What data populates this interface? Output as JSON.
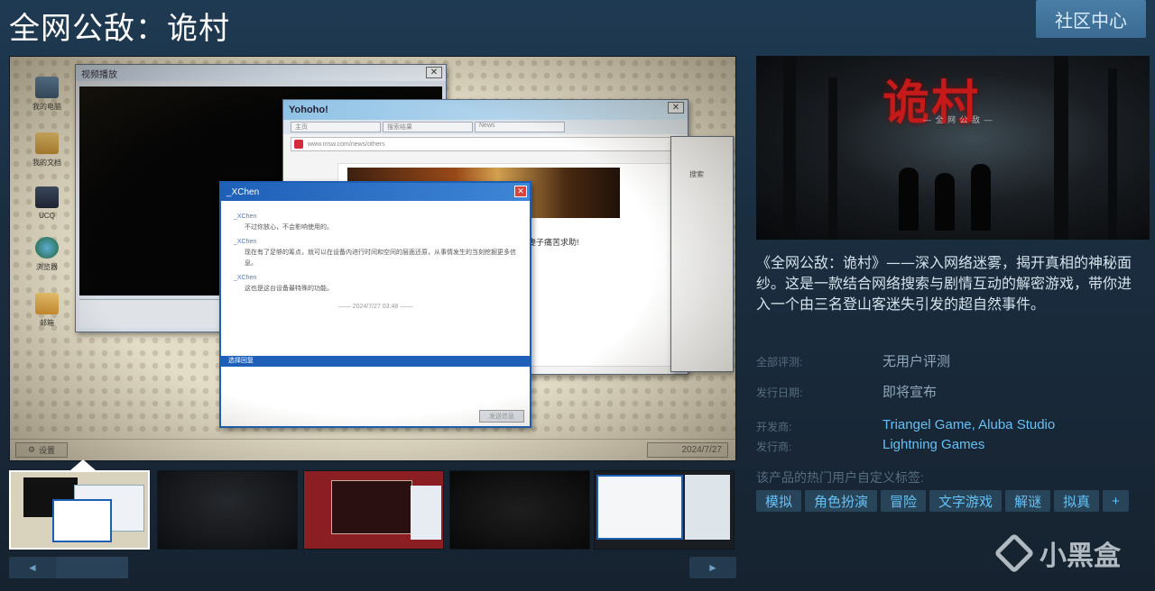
{
  "header": {
    "title": "全网公敌：诡村",
    "community_button": "社区中心"
  },
  "screenshot": {
    "desktop_icons": [
      "我的电脑",
      "我的文档",
      "UCQ",
      "浏览器",
      "邮箱"
    ],
    "video_window_title": "视频播放",
    "browser_window_title": "Yohoho!",
    "browser_tabs": [
      "主页",
      "搜索结果",
      "News"
    ],
    "browser_url": "www.msw.com/news/others",
    "article_snippet": "妻子痛苦求助!",
    "side_window_text": "搜索",
    "chat_window_title": "_XChen",
    "chat_messages": [
      {
        "name": "_XChen",
        "text": "不过你放心，不会影响使用的。"
      },
      {
        "name": "_XChen",
        "text": "现在有了足够的筹点，就可以在设备内进行时间和空间的层面还原，从事情发生的当刻挖掘更多信息。"
      },
      {
        "name": "_XChen",
        "text": "这也是这台设备最特殊的功能。"
      }
    ],
    "chat_time": "—— 2024/7/27 03:48 ——",
    "reply_label": "选择回复",
    "send_label": "发送信息",
    "settings_label": "设置",
    "taskbar_date": "2024/7/27"
  },
  "thumbnails": [
    "thumb-1",
    "thumb-2",
    "thumb-3",
    "thumb-4",
    "thumb-5"
  ],
  "scroll": {
    "left": "◄",
    "right": "►"
  },
  "capsule": {
    "title": "诡村",
    "subtitle": "— 全 网 公 敌 —"
  },
  "description": "《全网公敌：诡村》——深入网络迷雾，揭开真相的神秘面纱。这是一款结合网络搜索与剧情互动的解密游戏，带你进入一个由三名登山客迷失引发的超自然事件。",
  "info": {
    "reviews_label": "全部评测:",
    "reviews_value": "无用户评测",
    "release_label": "发行日期:",
    "release_value": "即将宣布",
    "developer_label": "开发商:",
    "developer_value": "Triangel Game, Aluba Studio",
    "publisher_label": "发行商:",
    "publisher_value": "Lightning Games"
  },
  "tags_title": "该产品的热门用户自定义标签:",
  "tags": [
    "模拟",
    "角色扮演",
    "冒险",
    "文字游戏",
    "解谜",
    "拟真",
    "+"
  ],
  "watermark": "小黑盒",
  "colors": {
    "link": "#66c0f4",
    "tag_bg": "#284459",
    "accent_btn": "#3a6a91"
  }
}
